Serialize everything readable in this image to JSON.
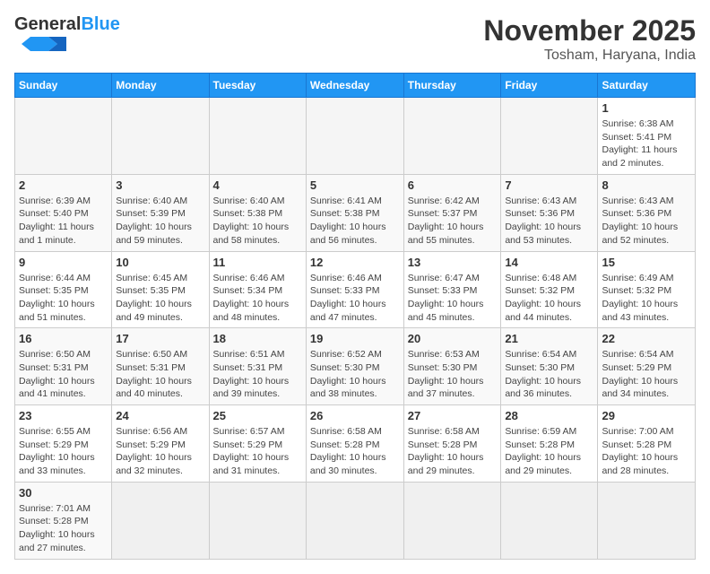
{
  "logo": {
    "general": "General",
    "blue": "Blue"
  },
  "header": {
    "month": "November 2025",
    "location": "Tosham, Haryana, India"
  },
  "days_of_week": [
    "Sunday",
    "Monday",
    "Tuesday",
    "Wednesday",
    "Thursday",
    "Friday",
    "Saturday"
  ],
  "weeks": [
    [
      {
        "day": "",
        "info": ""
      },
      {
        "day": "",
        "info": ""
      },
      {
        "day": "",
        "info": ""
      },
      {
        "day": "",
        "info": ""
      },
      {
        "day": "",
        "info": ""
      },
      {
        "day": "",
        "info": ""
      },
      {
        "day": "1",
        "info": "Sunrise: 6:38 AM\nSunset: 5:41 PM\nDaylight: 11 hours\nand 2 minutes."
      }
    ],
    [
      {
        "day": "2",
        "info": "Sunrise: 6:39 AM\nSunset: 5:40 PM\nDaylight: 11 hours\nand 1 minute."
      },
      {
        "day": "3",
        "info": "Sunrise: 6:40 AM\nSunset: 5:39 PM\nDaylight: 10 hours\nand 59 minutes."
      },
      {
        "day": "4",
        "info": "Sunrise: 6:40 AM\nSunset: 5:38 PM\nDaylight: 10 hours\nand 58 minutes."
      },
      {
        "day": "5",
        "info": "Sunrise: 6:41 AM\nSunset: 5:38 PM\nDaylight: 10 hours\nand 56 minutes."
      },
      {
        "day": "6",
        "info": "Sunrise: 6:42 AM\nSunset: 5:37 PM\nDaylight: 10 hours\nand 55 minutes."
      },
      {
        "day": "7",
        "info": "Sunrise: 6:43 AM\nSunset: 5:36 PM\nDaylight: 10 hours\nand 53 minutes."
      },
      {
        "day": "8",
        "info": "Sunrise: 6:43 AM\nSunset: 5:36 PM\nDaylight: 10 hours\nand 52 minutes."
      }
    ],
    [
      {
        "day": "9",
        "info": "Sunrise: 6:44 AM\nSunset: 5:35 PM\nDaylight: 10 hours\nand 51 minutes."
      },
      {
        "day": "10",
        "info": "Sunrise: 6:45 AM\nSunset: 5:35 PM\nDaylight: 10 hours\nand 49 minutes."
      },
      {
        "day": "11",
        "info": "Sunrise: 6:46 AM\nSunset: 5:34 PM\nDaylight: 10 hours\nand 48 minutes."
      },
      {
        "day": "12",
        "info": "Sunrise: 6:46 AM\nSunset: 5:33 PM\nDaylight: 10 hours\nand 47 minutes."
      },
      {
        "day": "13",
        "info": "Sunrise: 6:47 AM\nSunset: 5:33 PM\nDaylight: 10 hours\nand 45 minutes."
      },
      {
        "day": "14",
        "info": "Sunrise: 6:48 AM\nSunset: 5:32 PM\nDaylight: 10 hours\nand 44 minutes."
      },
      {
        "day": "15",
        "info": "Sunrise: 6:49 AM\nSunset: 5:32 PM\nDaylight: 10 hours\nand 43 minutes."
      }
    ],
    [
      {
        "day": "16",
        "info": "Sunrise: 6:50 AM\nSunset: 5:31 PM\nDaylight: 10 hours\nand 41 minutes."
      },
      {
        "day": "17",
        "info": "Sunrise: 6:50 AM\nSunset: 5:31 PM\nDaylight: 10 hours\nand 40 minutes."
      },
      {
        "day": "18",
        "info": "Sunrise: 6:51 AM\nSunset: 5:31 PM\nDaylight: 10 hours\nand 39 minutes."
      },
      {
        "day": "19",
        "info": "Sunrise: 6:52 AM\nSunset: 5:30 PM\nDaylight: 10 hours\nand 38 minutes."
      },
      {
        "day": "20",
        "info": "Sunrise: 6:53 AM\nSunset: 5:30 PM\nDaylight: 10 hours\nand 37 minutes."
      },
      {
        "day": "21",
        "info": "Sunrise: 6:54 AM\nSunset: 5:30 PM\nDaylight: 10 hours\nand 36 minutes."
      },
      {
        "day": "22",
        "info": "Sunrise: 6:54 AM\nSunset: 5:29 PM\nDaylight: 10 hours\nand 34 minutes."
      }
    ],
    [
      {
        "day": "23",
        "info": "Sunrise: 6:55 AM\nSunset: 5:29 PM\nDaylight: 10 hours\nand 33 minutes."
      },
      {
        "day": "24",
        "info": "Sunrise: 6:56 AM\nSunset: 5:29 PM\nDaylight: 10 hours\nand 32 minutes."
      },
      {
        "day": "25",
        "info": "Sunrise: 6:57 AM\nSunset: 5:29 PM\nDaylight: 10 hours\nand 31 minutes."
      },
      {
        "day": "26",
        "info": "Sunrise: 6:58 AM\nSunset: 5:28 PM\nDaylight: 10 hours\nand 30 minutes."
      },
      {
        "day": "27",
        "info": "Sunrise: 6:58 AM\nSunset: 5:28 PM\nDaylight: 10 hours\nand 29 minutes."
      },
      {
        "day": "28",
        "info": "Sunrise: 6:59 AM\nSunset: 5:28 PM\nDaylight: 10 hours\nand 29 minutes."
      },
      {
        "day": "29",
        "info": "Sunrise: 7:00 AM\nSunset: 5:28 PM\nDaylight: 10 hours\nand 28 minutes."
      }
    ],
    [
      {
        "day": "30",
        "info": "Sunrise: 7:01 AM\nSunset: 5:28 PM\nDaylight: 10 hours\nand 27 minutes."
      },
      {
        "day": "",
        "info": ""
      },
      {
        "day": "",
        "info": ""
      },
      {
        "day": "",
        "info": ""
      },
      {
        "day": "",
        "info": ""
      },
      {
        "day": "",
        "info": ""
      },
      {
        "day": "",
        "info": ""
      }
    ]
  ]
}
